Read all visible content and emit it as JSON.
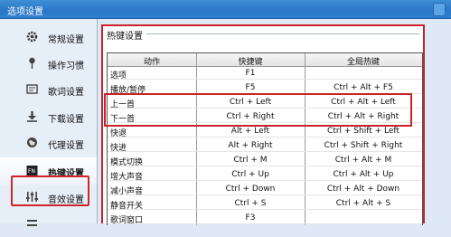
{
  "window": {
    "title": "选项设置"
  },
  "sidebar": {
    "items": [
      {
        "label": "常规设置",
        "icon": "gear-icon"
      },
      {
        "label": "操作习惯",
        "icon": "pin-icon"
      },
      {
        "label": "歌词设置",
        "icon": "lyrics-icon"
      },
      {
        "label": "下载设置",
        "icon": "download-icon"
      },
      {
        "label": "代理设置",
        "icon": "globe-icon"
      },
      {
        "label": "热键设置",
        "icon": "keyboard-icon"
      },
      {
        "label": "音效设置",
        "icon": "equalizer-icon"
      },
      {
        "label": "",
        "icon": "more-icon"
      }
    ],
    "active_index": 5
  },
  "hotkeys": {
    "section_title": "热键设置",
    "columns": [
      "动作",
      "快捷键",
      "全局热键"
    ],
    "rows": [
      {
        "action": "选项",
        "key": "F1",
        "global": ""
      },
      {
        "action": "播放/暂停",
        "key": "F5",
        "global": "Ctrl + Alt + F5"
      },
      {
        "action": "上一首",
        "key": "Ctrl + Left",
        "global": "Ctrl + Alt + Left"
      },
      {
        "action": "下一首",
        "key": "Ctrl + Right",
        "global": "Ctrl + Alt + Right"
      },
      {
        "action": "快退",
        "key": "Alt + Left",
        "global": "Ctrl + Shift + Left"
      },
      {
        "action": "快进",
        "key": "Alt + Right",
        "global": "Ctrl + Shift + Right"
      },
      {
        "action": "模式切换",
        "key": "Ctrl + M",
        "global": "Ctrl + Alt + M"
      },
      {
        "action": "增大声音",
        "key": "Ctrl + Up",
        "global": "Ctrl + Alt + Up"
      },
      {
        "action": "减小声音",
        "key": "Ctrl + Down",
        "global": "Ctrl + Alt + Down"
      },
      {
        "action": "静音开关",
        "key": "Ctrl + S",
        "global": "Ctrl + Alt + S"
      },
      {
        "action": "歌词窗口",
        "key": "F3",
        "global": ""
      }
    ]
  },
  "colors": {
    "highlight_red": "#c8222a",
    "titlebar_blue": "#2a78c6"
  }
}
